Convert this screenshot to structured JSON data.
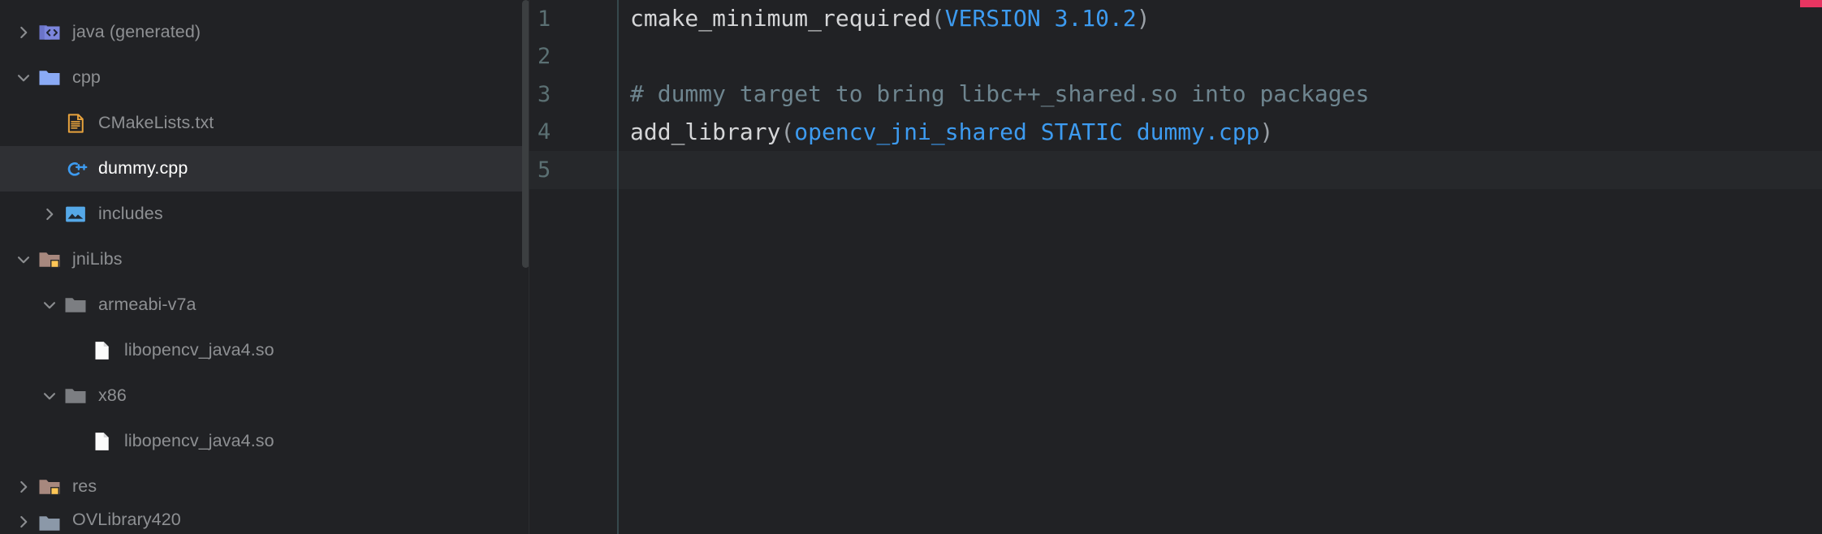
{
  "sidebar": {
    "name": "project-tree",
    "scrollbar_present": true,
    "items": [
      {
        "label": "java (generated)",
        "indent": 0,
        "arrow": "chevron-right",
        "icon": "code-folder-icon",
        "selected": false,
        "expanded": false
      },
      {
        "label": "cpp",
        "indent": 0,
        "arrow": "chevron-down",
        "icon": "folder-blue-icon",
        "selected": false,
        "expanded": true
      },
      {
        "label": "CMakeLists.txt",
        "indent": 1,
        "arrow": "none",
        "icon": "cmake-file-icon",
        "selected": false,
        "expanded": false
      },
      {
        "label": "dummy.cpp",
        "indent": 1,
        "arrow": "none",
        "icon": "cpp-file-icon",
        "selected": true,
        "expanded": false
      },
      {
        "label": "includes",
        "indent": 1,
        "arrow": "chevron-right",
        "icon": "includes-folder-icon",
        "selected": false,
        "expanded": false
      },
      {
        "label": "jniLibs",
        "indent": 0,
        "arrow": "chevron-down",
        "icon": "folder-resource-icon",
        "selected": false,
        "expanded": true
      },
      {
        "label": "armeabi-v7a",
        "indent": 1,
        "arrow": "chevron-down",
        "icon": "folder-gray-icon",
        "selected": false,
        "expanded": true
      },
      {
        "label": "libopencv_java4.so",
        "indent": 2,
        "arrow": "none",
        "icon": "binary-file-icon",
        "selected": false,
        "expanded": false
      },
      {
        "label": "x86",
        "indent": 1,
        "arrow": "chevron-down",
        "icon": "folder-gray-icon",
        "selected": false,
        "expanded": true
      },
      {
        "label": "libopencv_java4.so",
        "indent": 2,
        "arrow": "none",
        "icon": "binary-file-icon",
        "selected": false,
        "expanded": false
      },
      {
        "label": "res",
        "indent": 0,
        "arrow": "chevron-right",
        "icon": "folder-resource-icon",
        "selected": false,
        "expanded": false
      },
      {
        "label": "OVLibrary420",
        "indent": 0,
        "arrow": "chevron-right",
        "icon": "module-folder-icon",
        "selected": false,
        "expanded": false,
        "clipped": true
      }
    ]
  },
  "editor": {
    "name": "code-editor",
    "caret_line": 5,
    "gutter": {
      "line_numbers": [
        "1",
        "2",
        "3",
        "4",
        "5"
      ]
    },
    "lines": [
      {
        "number": "1",
        "tokens": [
          {
            "text": "cmake_minimum_required",
            "type": "default"
          },
          {
            "text": "(",
            "type": "paren"
          },
          {
            "text": "VERSION 3.10.2",
            "type": "arg"
          },
          {
            "text": ")",
            "type": "paren"
          }
        ]
      },
      {
        "number": "2",
        "tokens": []
      },
      {
        "number": "3",
        "tokens": [
          {
            "text": "# dummy target to bring libc++_shared.so into packages",
            "type": "comment"
          }
        ]
      },
      {
        "number": "4",
        "tokens": [
          {
            "text": "add_library",
            "type": "default"
          },
          {
            "text": "(",
            "type": "paren"
          },
          {
            "text": "opencv_jni_shared STATIC dummy.cpp",
            "type": "arg"
          },
          {
            "text": ")",
            "type": "paren"
          }
        ]
      },
      {
        "number": "5",
        "tokens": []
      }
    ]
  },
  "markers": {
    "top_stripe": {
      "name": "error-stripe-marker",
      "color": "#e73561"
    }
  },
  "colors": {
    "background": "#212225",
    "selected_row": "#2f3034",
    "caret_line": "#26282b",
    "text_muted": "#8e9093",
    "text_selected": "#ffffff",
    "code_default": "#d5d6d8",
    "code_arg": "#3d9bf0",
    "code_comment": "#6e858f",
    "gutter_number": "#5b7073",
    "gutter_divider": "#36494d",
    "accent_pink": "#e73561"
  }
}
